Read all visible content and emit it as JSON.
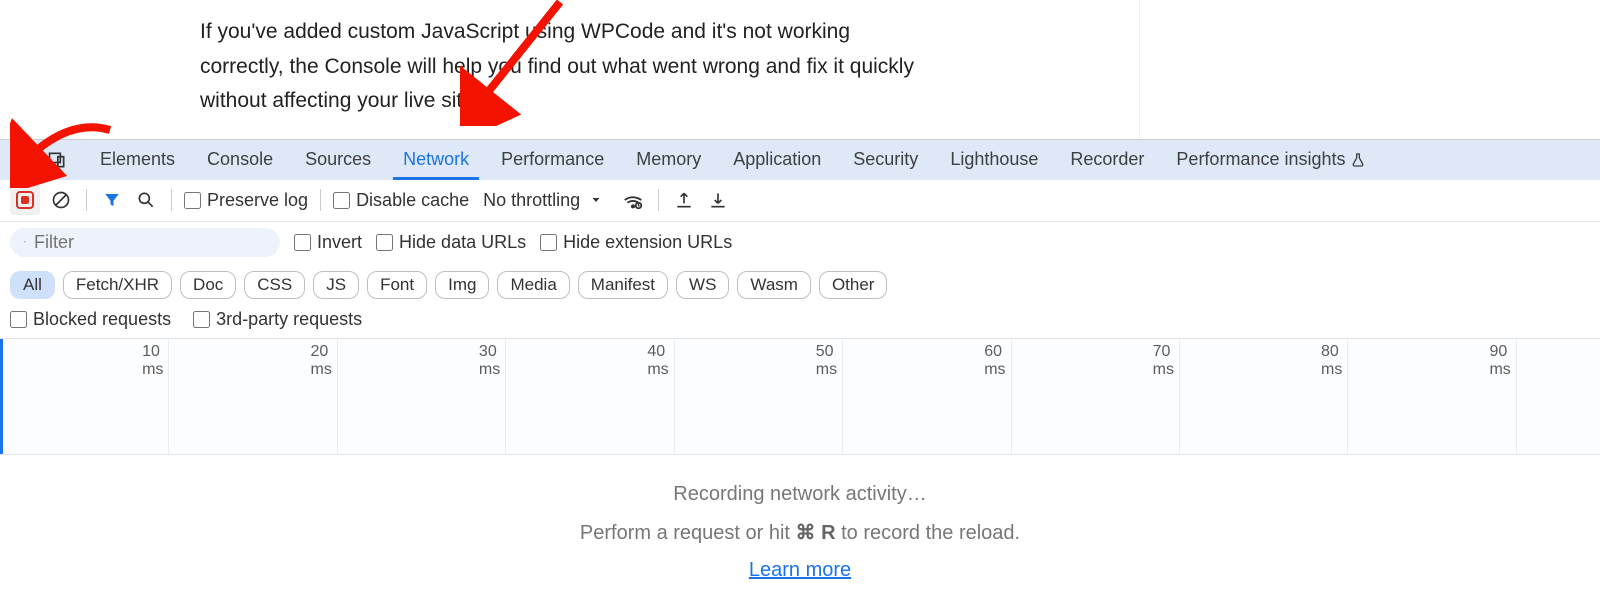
{
  "page": {
    "paragraph": "If you've added custom JavaScript using WPCode and it's not working correctly, the Console will help you find out what went wrong and fix it quickly without affecting your live site."
  },
  "tabs": {
    "items": [
      "Elements",
      "Console",
      "Sources",
      "Network",
      "Performance",
      "Memory",
      "Application",
      "Security",
      "Lighthouse",
      "Recorder",
      "Performance insights"
    ],
    "active": "Network"
  },
  "toolbar": {
    "preserve_log": "Preserve log",
    "disable_cache": "Disable cache",
    "throttling": "No throttling"
  },
  "filters": {
    "placeholder": "Filter",
    "invert": "Invert",
    "hide_data": "Hide data URLs",
    "hide_ext": "Hide extension URLs",
    "types": [
      "All",
      "Fetch/XHR",
      "Doc",
      "CSS",
      "JS",
      "Font",
      "Img",
      "Media",
      "Manifest",
      "WS",
      "Wasm",
      "Other"
    ],
    "active_type": "All",
    "blocked": "Blocked requests",
    "third_party": "3rd-party requests"
  },
  "timeline": {
    "ticks": [
      "10 ms",
      "20 ms",
      "30 ms",
      "40 ms",
      "50 ms",
      "60 ms",
      "70 ms",
      "80 ms",
      "90 ms"
    ]
  },
  "empty": {
    "line1": "Recording network activity…",
    "line2_prefix": "Perform a request or hit ",
    "line2_key": "⌘ R",
    "line2_suffix": " to record the reload.",
    "learn": "Learn more"
  }
}
